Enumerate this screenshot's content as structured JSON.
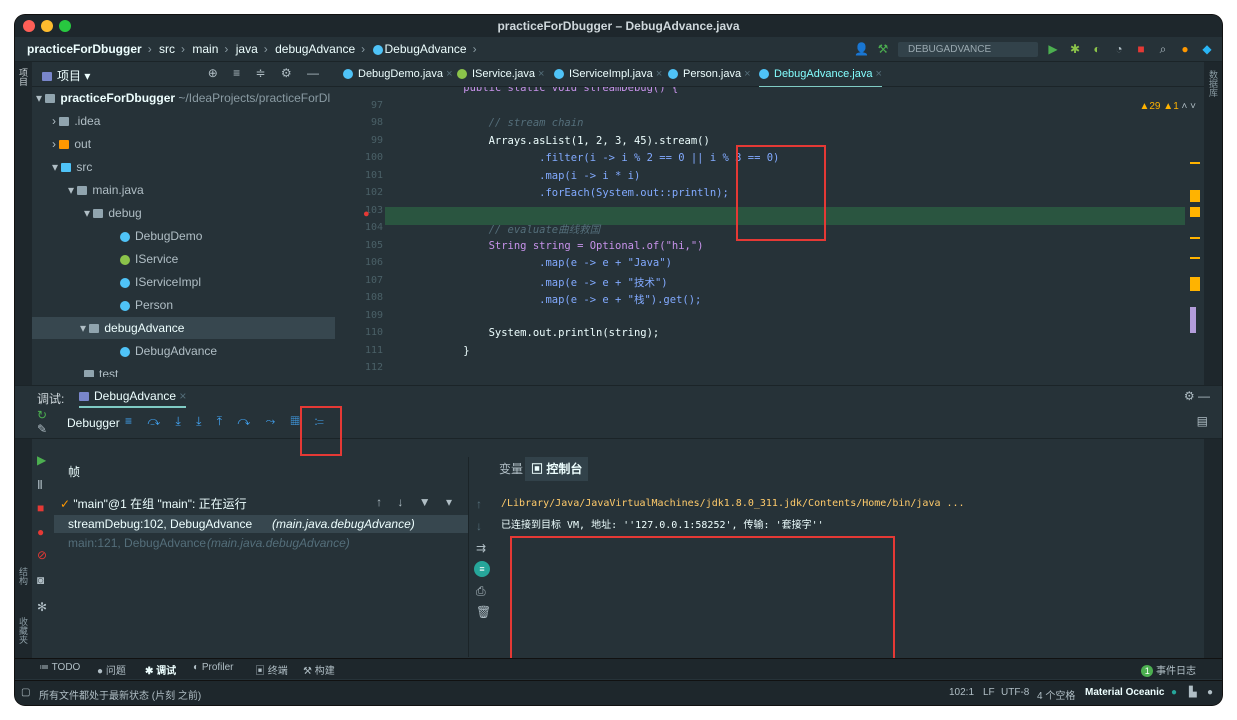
{
  "window": {
    "title": "practiceForDbugger – DebugAdvance.java"
  },
  "breadcrumb": [
    "practiceForDbugger",
    "src",
    "main",
    "java",
    "debugAdvance",
    "DebugAdvance"
  ],
  "run_config": "DEBUGADVANCE",
  "project_panel": {
    "label": "项目",
    "side_label": "项目"
  },
  "right_strip_label": "数据库",
  "tree": [
    {
      "label": "practiceForDbugger",
      "suffix": "~/IdeaProjects/practiceForDl",
      "type": "module"
    },
    {
      "label": ".idea",
      "type": "folder"
    },
    {
      "label": "out",
      "type": "folder-orange"
    },
    {
      "label": "src",
      "type": "folder"
    },
    {
      "label": "main.java",
      "type": "folder"
    },
    {
      "label": "debug",
      "type": "folder"
    },
    {
      "label": "DebugDemo",
      "type": "class"
    },
    {
      "label": "IService",
      "type": "interface"
    },
    {
      "label": "IServiceImpl",
      "type": "class"
    },
    {
      "label": "Person",
      "type": "class"
    },
    {
      "label": "debugAdvance",
      "type": "folder"
    },
    {
      "label": "DebugAdvance",
      "type": "class"
    },
    {
      "label": "test",
      "type": "folder"
    }
  ],
  "editor_tabs": [
    "DebugDemo.java",
    "IService.java",
    "IServiceImpl.java",
    "Person.java",
    "DebugAdvance.java"
  ],
  "inspections": {
    "warnings": "29",
    "weak_warnings": "1"
  },
  "code_lines": [
    {
      "n": "",
      "t": "    public static void streamDebug() {"
    },
    {
      "n": "97",
      "t": ""
    },
    {
      "n": "98",
      "t": "        // stream chain"
    },
    {
      "n": "99",
      "t": "        Arrays.asList(1, 2, 3, 45).stream()"
    },
    {
      "n": "100",
      "t": "                .filter(i -> i % 2 == 0 || i % 3 == 0)"
    },
    {
      "n": "101",
      "t": "                .map(i -> i * i)"
    },
    {
      "n": "102",
      "t": "                .forEach(System.out::println);"
    },
    {
      "n": "103",
      "t": ""
    },
    {
      "n": "104",
      "t": "        // evaluate曲线救国"
    },
    {
      "n": "105",
      "t": "        String string = Optional.of(\"hi,\")"
    },
    {
      "n": "106",
      "t": "                .map(e -> e + \"Java\")"
    },
    {
      "n": "107",
      "t": "                .map(e -> e + \"技术\")"
    },
    {
      "n": "108",
      "t": "                .map(e -> e + \"栈\").get();"
    },
    {
      "n": "109",
      "t": ""
    },
    {
      "n": "110",
      "t": "        System.out.println(string);"
    },
    {
      "n": "111",
      "t": "    }"
    },
    {
      "n": "112",
      "t": ""
    }
  ],
  "debug": {
    "label": "调试:",
    "tab": "DebugAdvance",
    "debugger_label": "Debugger",
    "frames_header": "帧",
    "thread": "\"main\"@1 在组 \"main\": 正在运行",
    "frames": [
      {
        "method": "streamDebug:102, DebugAdvance",
        "pkg": "(main.java.debugAdvance)"
      },
      {
        "method": "main:121, DebugAdvance",
        "pkg": "(main.java.debugAdvance)"
      }
    ],
    "variables_tab": "变量",
    "console_tab": "控制台",
    "console_lines": [
      "/Library/Java/JavaVirtualMachines/jdk1.8.0_311.jdk/Contents/Home/bin/java ...",
      "已连接到目标 VM, 地址: ''127.0.0.1:58252', 传输: '套接字''"
    ]
  },
  "side_labels": {
    "structure": "结构",
    "favorites": "收藏夹"
  },
  "bottom_tabs": [
    "TODO",
    "问题",
    "调试",
    "Profiler",
    "终端",
    "构建"
  ],
  "event_log": "事件日志",
  "event_count": "1",
  "status": {
    "message": "所有文件都处于最新状态 (片刻 之前)",
    "position": "102:1",
    "line_sep": "LF",
    "encoding": "UTF-8",
    "indent": "4 个空格",
    "theme": "Material Oceanic"
  },
  "colors": {
    "bg": "#263238",
    "accent": "#80cbc4",
    "keyword": "#c792ea",
    "string": "#c3e88d",
    "comment": "#546e7a",
    "function": "#82aaff"
  }
}
